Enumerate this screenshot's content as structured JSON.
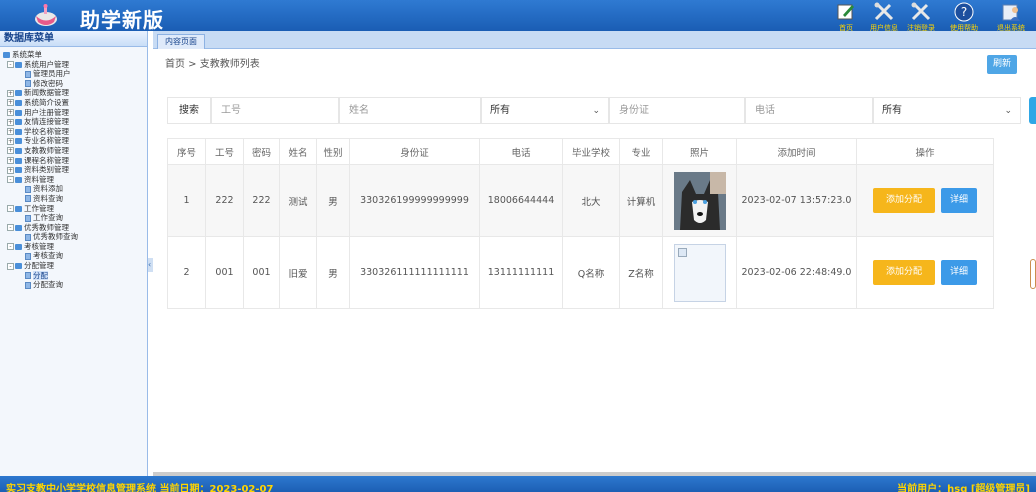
{
  "header": {
    "title": "助学新版",
    "tools": [
      {
        "label": "首页",
        "icon": "edit-icon"
      },
      {
        "label": "用户信息",
        "icon": "tools-icon"
      },
      {
        "label": "注销登录",
        "icon": "tools-icon"
      },
      {
        "label": "使用帮助",
        "icon": "help-icon"
      },
      {
        "label": "退出系统",
        "icon": "user-icon"
      }
    ]
  },
  "sidebar": {
    "title": "数据库菜单",
    "root": "系统菜单",
    "groups": [
      {
        "label": "系统用户管理",
        "children": [
          "管理员用户",
          "修改密码"
        ]
      },
      {
        "label": "新闻数据管理"
      },
      {
        "label": "系统简介设置"
      },
      {
        "label": "用户注册管理"
      },
      {
        "label": "友情连接管理"
      },
      {
        "label": "学校名称管理"
      },
      {
        "label": "专业名称管理"
      },
      {
        "label": "支教教师管理"
      },
      {
        "label": "课程名称管理"
      },
      {
        "label": "资料类别管理"
      },
      {
        "label": "资料管理",
        "children": [
          "资料添加",
          "资料查询"
        ]
      },
      {
        "label": "工作管理",
        "children": [
          "工作查询"
        ]
      },
      {
        "label": "优秀教师管理",
        "children": [
          "优秀教师查询"
        ]
      },
      {
        "label": "考核管理",
        "children": [
          "考核查询"
        ]
      },
      {
        "label": "分配管理",
        "children": [
          "分配",
          "分配查询"
        ]
      }
    ]
  },
  "tabs": {
    "active": "内容页面"
  },
  "breadcrumb": "首页 > 支教教师列表",
  "refresh_label": "刷新",
  "search": {
    "label": "搜索",
    "placeholders": {
      "job_no": "工号",
      "name": "姓名",
      "id_card": "身份证",
      "phone": "电话"
    },
    "select1": "所有",
    "select2": "所有"
  },
  "table": {
    "headers": [
      "序号",
      "工号",
      "密码",
      "姓名",
      "性别",
      "身份证",
      "电话",
      "毕业学校",
      "专业",
      "照片",
      "添加时间",
      "操作"
    ],
    "rows": [
      {
        "no": "1",
        "job_no": "222",
        "password": "222",
        "name": "测试",
        "gender": "男",
        "id_card": "330326199999999999",
        "phone": "18006644444",
        "school": "北大",
        "major": "计算机",
        "photo": "husky-photo",
        "added": "2023-02-07 13:57:23.0"
      },
      {
        "no": "2",
        "job_no": "001",
        "password": "001",
        "name": "旧爱",
        "gender": "男",
        "id_card": "330326111111111111",
        "phone": "13111111111",
        "school": "Q名称",
        "major": "Z名称",
        "photo": "broken-image",
        "added": "2023-02-06 22:48:49.0"
      }
    ],
    "actions": {
      "assign": "添加分配",
      "detail": "详细"
    }
  },
  "status": {
    "left": "实习支教中小学学校信息管理系统 当前日期：2023-02-07",
    "right": "当前用户：hsg [超级管理员]"
  },
  "colors": {
    "header": "#1f66bf",
    "accent_yellow": "#f6b61b",
    "accent_blue": "#3c9ae8",
    "status_text": "#ffd400"
  }
}
